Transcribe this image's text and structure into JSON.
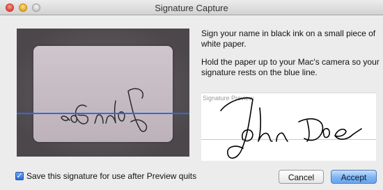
{
  "window": {
    "title": "Signature Capture"
  },
  "instructions": {
    "line1": "Sign your name in black ink on a small piece of white paper.",
    "line2": "Hold the paper up to your Mac's camera so your signature rests on the blue line."
  },
  "preview": {
    "label": "Signature Preview"
  },
  "save_option": {
    "label": "Save this signature for use after Preview quits",
    "checked": true
  },
  "buttons": {
    "cancel": "Cancel",
    "accept": "Accept"
  },
  "colors": {
    "guide_line": "#2f6be0",
    "accept_button": "#7fb3f2"
  },
  "signature_text": "John Doe"
}
